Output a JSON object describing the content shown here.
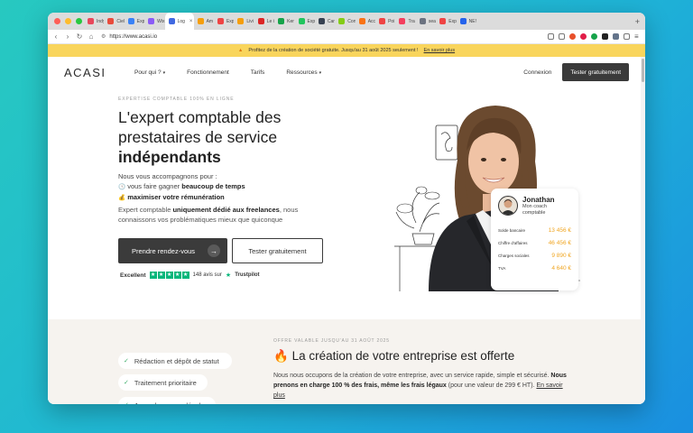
{
  "browser": {
    "traffic_colors": [
      "#ff5f57",
      "#febc2e",
      "#28c840"
    ],
    "tabs": [
      {
        "label": "Indy",
        "color": "#e8475a"
      },
      {
        "label": "Ciel",
        "color": "#e84b3c"
      },
      {
        "label": "Exp",
        "color": "#3b82f6"
      },
      {
        "label": "Wix",
        "color": "#8b5cf6"
      },
      {
        "label": "Log",
        "color": "#4169e1",
        "active": true
      },
      {
        "label": "Am",
        "color": "#f59e0b"
      },
      {
        "label": "Exp",
        "color": "#ef4444"
      },
      {
        "label": "Livi",
        "color": "#f59e0b"
      },
      {
        "label": "Le i",
        "color": "#dc2626"
      },
      {
        "label": "Ker",
        "color": "#16a34a"
      },
      {
        "label": "Exp",
        "color": "#22c55e"
      },
      {
        "label": "Car",
        "color": "#374151"
      },
      {
        "label": "Con",
        "color": "#84cc16"
      },
      {
        "label": "Acc",
        "color": "#f97316"
      },
      {
        "label": "Poi",
        "color": "#ef4444"
      },
      {
        "label": "Tra",
        "color": "#f43f5e"
      },
      {
        "label": "sea",
        "color": "#6b7280"
      },
      {
        "label": "Exp",
        "color": "#ef4444"
      },
      {
        "label": "NE!",
        "color": "#2563eb"
      }
    ],
    "url": "https://www.acasi.io"
  },
  "promo": {
    "text": "Profitez de la création de société gratuite. Jusqu'au 31 août 2025 seulement !",
    "link": "En savoir plus"
  },
  "nav": {
    "logo": "ACASI",
    "items": [
      {
        "label": "Pour qui ?",
        "dropdown": true
      },
      {
        "label": "Fonctionnement",
        "dropdown": false
      },
      {
        "label": "Tarifs",
        "dropdown": false
      },
      {
        "label": "Ressources",
        "dropdown": true
      }
    ],
    "login": "Connexion",
    "cta": "Tester gratuitement"
  },
  "hero": {
    "kicker": "EXPERTISE COMPTABLE 100% EN LIGNE",
    "title_line1": "L'expert comptable des",
    "title_line2": "prestataires de service",
    "title_line3": "indépendants",
    "lead_intro": "Nous vous accompagnons pour :",
    "lead_line1_pre": "vous faire gagner ",
    "lead_line1_bold": "beaucoup de temps",
    "lead_line2_bold": "maximiser votre rémunération",
    "lead2_pre": "Expert comptable ",
    "lead2_bold": "uniquement dédié aux freelances",
    "lead2_post": ", nous connaissons vos problématiques mieux que quiconque",
    "cta_primary": "Prendre rendez-vous",
    "cta_secondary": "Tester gratuitement",
    "trust_label": "Excellent",
    "trust_reviews": "148 avis sur",
    "trust_brand": "Trustpilot"
  },
  "coach": {
    "name": "Jonathan",
    "role_line1": "Mon coach",
    "role_line2": "comptable",
    "rows": [
      {
        "label": "Solde bancaire",
        "value": "13 456 €"
      },
      {
        "label": "Chiffre d'affaires",
        "value": "46 456 €"
      },
      {
        "label": "Charges sociales",
        "value": "9 890 €"
      },
      {
        "label": "TVA",
        "value": "4 640 €"
      }
    ]
  },
  "offer": {
    "features": [
      "Rédaction et dépôt de statut",
      "Traitement prioritaire",
      "Journal annonce légale"
    ],
    "kicker": "OFFRE VALABLE JUSQU'AU 31 AOÛT 2025",
    "title": "La création de votre entreprise est offerte",
    "text_pre": "Nous nous occupons de la création de votre entreprise, avec un service rapide, simple et sécurisé. ",
    "text_bold": "Nous prenons en charge 100 % des frais, même les frais légaux",
    "text_post": " (pour une valeur de 299 € HT). ",
    "link": "En savoir plus"
  }
}
